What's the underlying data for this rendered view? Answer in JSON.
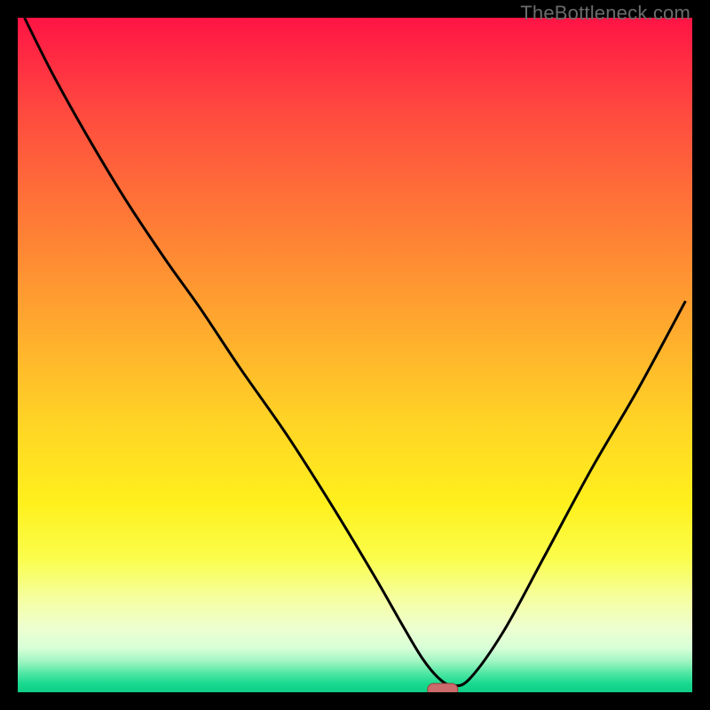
{
  "watermark": {
    "text": "TheBottleneck.com"
  },
  "colors": {
    "frame": "#000000",
    "curve": "#000000",
    "marker_fill": "#cc6b6b",
    "marker_stroke": "#993f3f",
    "gradient_stops": [
      {
        "offset": 0.0,
        "color": "#ff1445"
      },
      {
        "offset": 0.14,
        "color": "#ff4a3f"
      },
      {
        "offset": 0.3,
        "color": "#ff7a36"
      },
      {
        "offset": 0.46,
        "color": "#ffaa2e"
      },
      {
        "offset": 0.6,
        "color": "#ffd425"
      },
      {
        "offset": 0.72,
        "color": "#fff01d"
      },
      {
        "offset": 0.8,
        "color": "#fbfd4a"
      },
      {
        "offset": 0.86,
        "color": "#f5ff9e"
      },
      {
        "offset": 0.905,
        "color": "#eeffd0"
      },
      {
        "offset": 0.935,
        "color": "#d7ffd7"
      },
      {
        "offset": 0.955,
        "color": "#9cf5c0"
      },
      {
        "offset": 0.972,
        "color": "#4fe6a3"
      },
      {
        "offset": 0.988,
        "color": "#17d98e"
      },
      {
        "offset": 1.0,
        "color": "#0fce87"
      }
    ]
  },
  "chart_data": {
    "type": "line",
    "title": "",
    "xlabel": "",
    "ylabel": "",
    "xlim": [
      0,
      100
    ],
    "ylim": [
      0,
      100
    ],
    "grid": false,
    "legend": false,
    "marker": {
      "x": 63,
      "y": 0.4,
      "width": 4.5,
      "height": 1.8
    },
    "series": [
      {
        "name": "curve",
        "x": [
          1,
          5,
          10,
          16,
          22,
          27,
          33,
          40,
          47,
          53,
          57,
          60,
          62.5,
          64.5,
          67,
          72,
          78,
          85,
          92,
          99
        ],
        "y": [
          100,
          92,
          83,
          73,
          64,
          57,
          48,
          38,
          27,
          17,
          10,
          5,
          2,
          1,
          2,
          9,
          20,
          33,
          45,
          58
        ]
      }
    ]
  }
}
